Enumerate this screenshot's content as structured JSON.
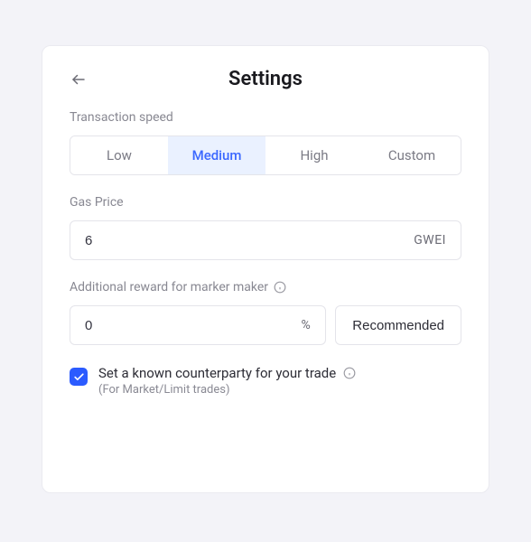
{
  "title": "Settings",
  "transaction_speed": {
    "label": "Transaction speed",
    "options": {
      "low": "Low",
      "medium": "Medium",
      "high": "High",
      "custom": "Custom"
    },
    "selected": "medium"
  },
  "gas_price": {
    "label": "Gas Price",
    "value": "6",
    "unit": "GWEI"
  },
  "additional_reward": {
    "label": "Additional reward for marker maker",
    "value": "0",
    "unit": "%",
    "recommended_label": "Recommended"
  },
  "counterparty": {
    "label": "Set a known counterparty for your trade",
    "sublabel": "(For Market/Limit trades)",
    "checked": true
  }
}
